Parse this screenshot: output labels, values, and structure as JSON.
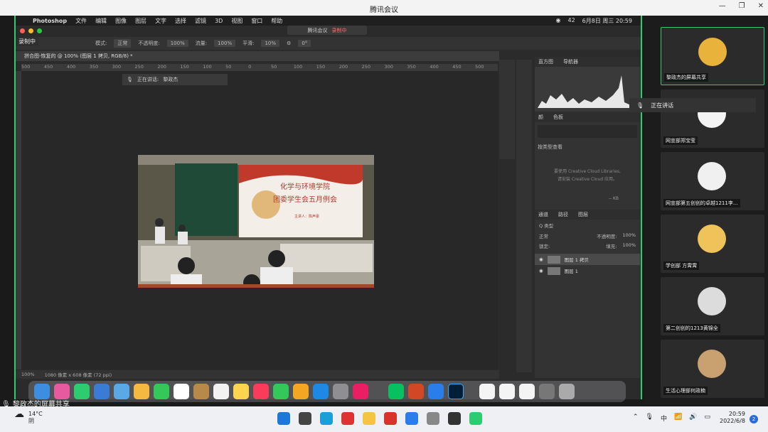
{
  "window": {
    "title": "腾讯会议"
  },
  "mac_menu": {
    "app": "Photoshop",
    "items": [
      "文件",
      "编辑",
      "图像",
      "图层",
      "文字",
      "选择",
      "滤镜",
      "3D",
      "视图",
      "窗口",
      "帮助"
    ],
    "battery_count": "42",
    "datetime": "6月8日 周三 20:59"
  },
  "meeting_badge": {
    "app": "腾讯会议",
    "status": "录制中"
  },
  "recording_label": "录制中",
  "options_bar": {
    "mode_label": "模式:",
    "mode": "正常",
    "opacity_label": "不透明度:",
    "opacity": "100%",
    "flow_label": "流量:",
    "flow": "100%",
    "smooth_label": "平滑:",
    "smooth": "10%",
    "angle": "0°"
  },
  "doc_tab": "拼合图-恢复的 @ 100% (图层 1 拷贝, RGB/8) *",
  "ruler": [
    "500",
    "450",
    "400",
    "350",
    "300",
    "250",
    "200",
    "150",
    "100",
    "50",
    "0",
    "50",
    "100",
    "150",
    "200",
    "250",
    "300",
    "350",
    "400",
    "450",
    "500",
    "550",
    "600",
    "650",
    "700",
    "750",
    "800",
    "850",
    "900",
    "950",
    "1000",
    "1050",
    "1100",
    "1150",
    "1200",
    "1250",
    "1300",
    "1350",
    "1400",
    "1450",
    "1500",
    "1550",
    "1600",
    "1650"
  ],
  "speaking": {
    "label": "正在讲话:",
    "name": "黎政杰"
  },
  "photo": {
    "slide_line1": "化学与环境学院",
    "slide_line2": "团委学生会五月例会",
    "slide_sub": "主讲人：陈声豪"
  },
  "status_bar": {
    "zoom": "100%",
    "size": "1080 像素 x 608 像素 (72 ppi)"
  },
  "right_panel": {
    "tabs_top": [
      "直方图",
      "导航器"
    ],
    "tabs_mid": [
      "颜",
      "色板"
    ],
    "library_view": "按类型查看",
    "library_msg1": "要使用 Creative Cloud Libraries,",
    "library_msg2": "请安装 Creative Cloud 应用。",
    "kb": "-- KB",
    "layer_tabs": [
      "通道",
      "路径",
      "图层"
    ],
    "kind": "Q 类型",
    "blend": "正常",
    "opacity_label": "不透明度:",
    "opacity": "100%",
    "lock_label": "锁定:",
    "fill_label": "填充:",
    "fill": "100%",
    "layers": [
      "图层 1 拷贝",
      "图层 1"
    ]
  },
  "sharer_label": "黎政杰的屏幕共享",
  "speaking_popup": "正在讲话",
  "participants": [
    {
      "name": "黎政杰的屏幕共享",
      "color": "#e9b23a"
    },
    {
      "name": "网宣部郑宝莹",
      "color": "#f4f4f4"
    },
    {
      "name": "网宣部第五创创的卓越1211李...",
      "color": "#f0f0f0"
    },
    {
      "name": "学创部 方霄霄",
      "color": "#f0c25a"
    },
    {
      "name": "第二创创的1213黄锦全",
      "color": "#dcdcdc"
    },
    {
      "name": "生活心理部何政楠",
      "color": "#c9a070"
    }
  ],
  "taskbar": {
    "temp": "14°C",
    "weather": "阴",
    "ime": "中",
    "time": "20:59",
    "date": "2022/6/8",
    "notifications": "2"
  }
}
